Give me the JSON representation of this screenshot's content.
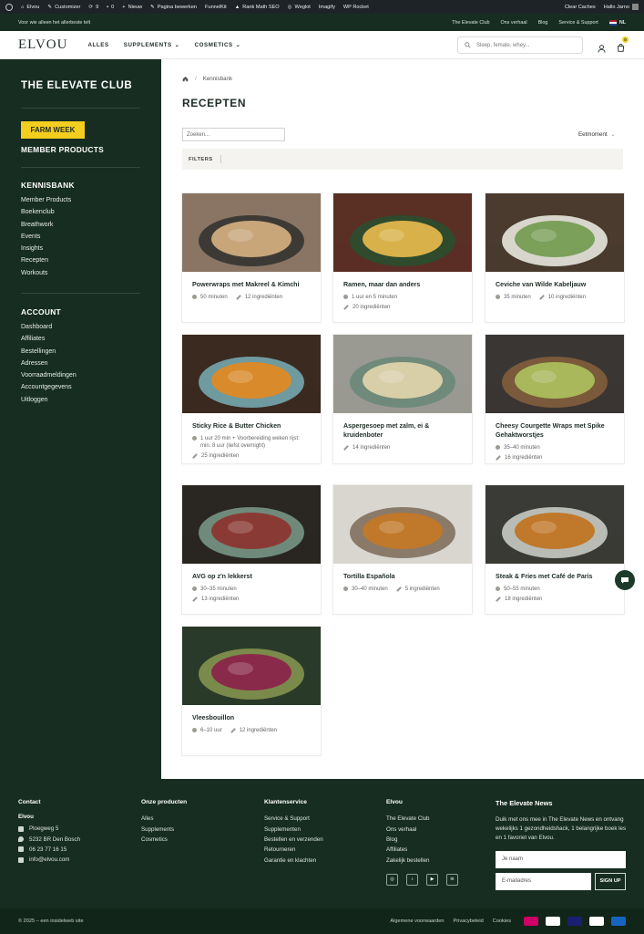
{
  "adminbar": {
    "items": [
      "Elvou",
      "Customizer",
      "9",
      "0",
      "Nieuw",
      "Pagina bewerken",
      "FunnelKit",
      "Rank Math SEO",
      "Weglot",
      "Imagify",
      "WP Rocket"
    ],
    "right": [
      "Clear Caches",
      "Hallo Jarno"
    ]
  },
  "topbar": {
    "promo": "Voor wie alleen het allerbeste telt",
    "links": [
      "The Elevate Club",
      "Ons verhaal",
      "Blog",
      "Service & Support"
    ],
    "lang": "NL"
  },
  "header": {
    "logo": "ELVOU",
    "nav": [
      "ALLES",
      "SUPPLEMENTS",
      "COSMETICS"
    ],
    "search_placeholder": "Sleep, female, whey...",
    "cart_count": "0"
  },
  "sidebar": {
    "title": "THE ELEVATE CLUB",
    "farm_week": "FARM WEEK",
    "member_products": "MEMBER PRODUCTS",
    "kennisbank_title": "KENNISBANK",
    "kennisbank_items": [
      "Member Products",
      "Boekenclub",
      "Breathwork",
      "Events",
      "Insights",
      "Recepten",
      "Workouts"
    ],
    "account_title": "ACCOUNT",
    "account_items": [
      "Dashboard",
      "Affiliates",
      "Bestellingen",
      "Adressen",
      "Voorraadmeldingen",
      "Accountgegevens",
      "Uitloggen"
    ]
  },
  "main": {
    "breadcrumb": "Kennisbank",
    "title": "RECEPTEN",
    "search_placeholder": "Zoeken...",
    "sort": "Eetmoment",
    "filters": "FILTERS"
  },
  "recipes": [
    {
      "title": "Powerwraps met Makreel & Kimchi",
      "time": "50 minuten",
      "ingredients": "12 ingrediënten",
      "layout": "inline",
      "colors": [
        "#8a7564",
        "#3d3a36",
        "#c8a67a"
      ]
    },
    {
      "title": "Ramen, maar dan anders",
      "time": "1 uur en 5 minuten",
      "ingredients": "20 ingrediënten",
      "layout": "stacked",
      "colors": [
        "#5a2f24",
        "#2f4a2c",
        "#d8b14a"
      ]
    },
    {
      "title": "Ceviche van Wilde Kabeljauw",
      "time": "35 minuten",
      "ingredients": "10 ingrediënten",
      "layout": "inline",
      "colors": [
        "#4a3b2e",
        "#d8d6cc",
        "#7aa05a"
      ]
    },
    {
      "title": "Sticky Rice & Butter Chicken",
      "time": "1 uur 20 min + Voorbereiding weken rijst: min. 8 uur (liefst overnight)",
      "ingredients": "25 ingrediënten",
      "layout": "stacked",
      "colors": [
        "#3a2a20",
        "#6f9aa0",
        "#d98a2a"
      ]
    },
    {
      "title": "Aspergesoep met zalm, ei & kruidenboter",
      "time": "",
      "ingredients": "14 ingrediënten",
      "layout": "stacked",
      "colors": [
        "#9a9a92",
        "#6f8a7a",
        "#d8cfa8"
      ]
    },
    {
      "title": "Cheesy Courgette Wraps met Spike Gehaktworstjes",
      "time": "35–40 minuten",
      "ingredients": "16 ingrediënten",
      "layout": "stacked",
      "colors": [
        "#3a3634",
        "#7a5a3a",
        "#a8b85a"
      ]
    },
    {
      "title": "AVG op z'n lekkerst",
      "time": "30–35 minuten",
      "ingredients": "13 ingrediënten",
      "layout": "stacked",
      "colors": [
        "#2a2622",
        "#6f8a7a",
        "#8a3a34"
      ]
    },
    {
      "title": "Tortilla Española",
      "time": "30–40 minuten",
      "ingredients": "5 ingrediënten",
      "layout": "inline",
      "colors": [
        "#d9d6d0",
        "#8a7a6a",
        "#c0782a"
      ]
    },
    {
      "title": "Steak & Fries met Café de Paris",
      "time": "50–55 minuten",
      "ingredients": "18 ingrediënten",
      "layout": "stacked",
      "colors": [
        "#3a3a36",
        "#b8bcb4",
        "#c0782a"
      ]
    },
    {
      "title": "Vleesbouillon",
      "time": "6–10 uur",
      "ingredients": "12 ingrediënten",
      "layout": "inline",
      "colors": [
        "#2a3a2a",
        "#7a8a4a",
        "#8a2a4a"
      ]
    }
  ],
  "footer": {
    "contact": {
      "title": "Contact",
      "name": "Elvou",
      "lines": [
        "Ploegweg 5",
        "5232 BR Den Bosch",
        "06 23 77 16 15",
        "info@elvou.com"
      ]
    },
    "products": {
      "title": "Onze producten",
      "items": [
        "Alles",
        "Supplements",
        "Cosmetics"
      ]
    },
    "service": {
      "title": "Klantenservice",
      "items": [
        "Service & Support",
        "Supplementen",
        "Bestellen en verzenden",
        "Retourneren",
        "Garantie en klachten"
      ]
    },
    "elvou": {
      "title": "Elvou",
      "items": [
        "The Elevate Club",
        "Ons verhaal",
        "Blog",
        "Affiliates",
        "Zakelijk bestellen"
      ]
    },
    "news": {
      "title": "The Elevate News",
      "text": "Duik met ons mee in The Elevate News en ontvang wekelijks 1 gezondheidshack, 1 belangrijke boek les en 1 favoriet van Elvou.",
      "name_placeholder": "Je naam",
      "email_placeholder": "E-mailadres",
      "button": "SIGN UP"
    },
    "copyright": "© 2025 – een insidelweb site",
    "legal": [
      "Algemene voorwaarden",
      "Privacybeleid",
      "Cookies"
    ]
  },
  "colors": {
    "brand_green": "#172d22",
    "accent_yellow": "#f3ce1f"
  }
}
